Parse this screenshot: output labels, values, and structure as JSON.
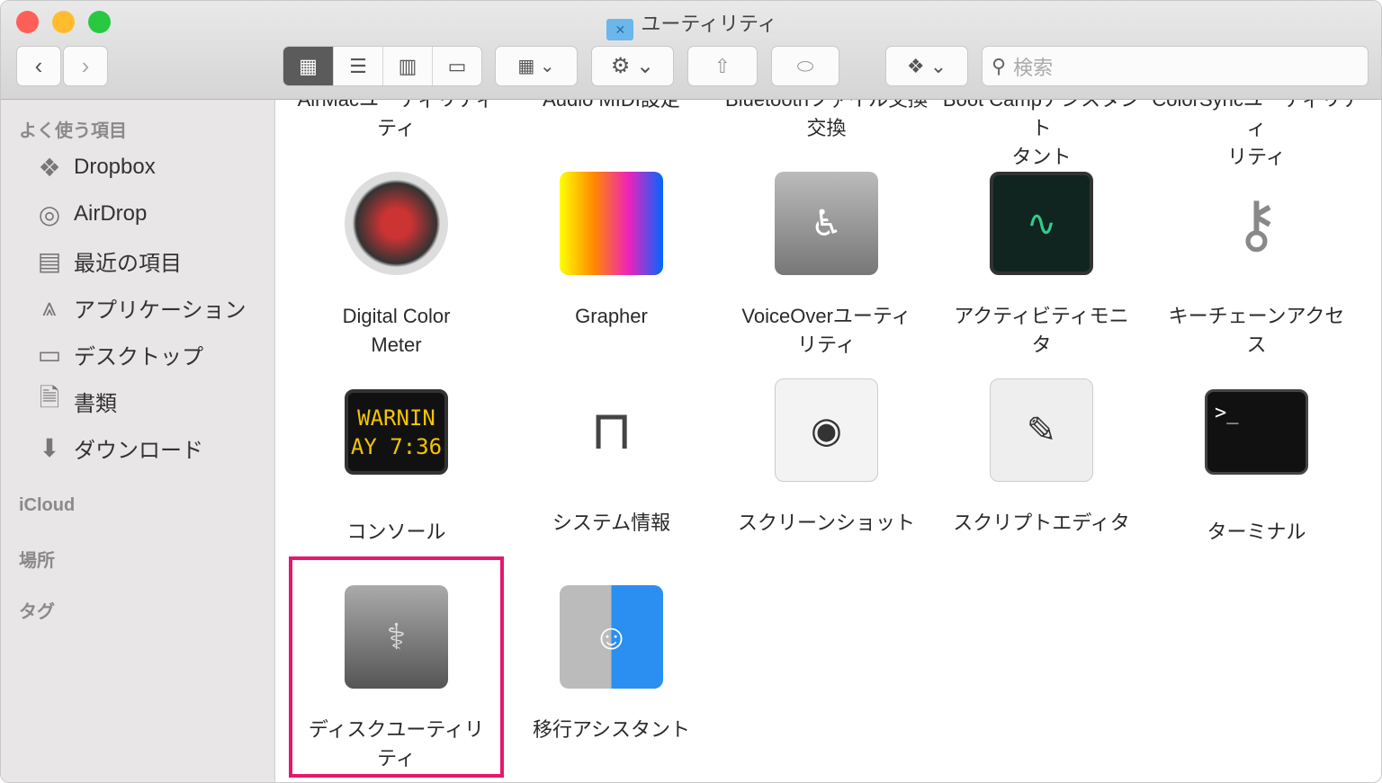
{
  "window": {
    "title": "ユーティリティ"
  },
  "toolbar": {
    "back": "‹",
    "forward": "›",
    "search_placeholder": "検索",
    "view_modes": [
      "icon",
      "list",
      "column",
      "gallery"
    ],
    "active_view": "icon"
  },
  "sidebar": {
    "favorites_header": "よく使う項目",
    "items": [
      {
        "label": "Dropbox",
        "icon": "dropbox-icon"
      },
      {
        "label": "AirDrop",
        "icon": "airdrop-icon"
      },
      {
        "label": "最近の項目",
        "icon": "recents-icon"
      },
      {
        "label": "アプリケーション",
        "icon": "applications-icon"
      },
      {
        "label": "デスクトップ",
        "icon": "desktop-icon"
      },
      {
        "label": "書類",
        "icon": "documents-icon"
      },
      {
        "label": "ダウンロード",
        "icon": "downloads-icon"
      }
    ],
    "icloud_header": "iCloud",
    "locations_header": "場所",
    "tags_header": "タグ"
  },
  "apps_partial": [
    "AirMacユーティリティ",
    "Audio MIDI設定",
    "Bluetoothファイル交換",
    "Boot Campアシスタント",
    "ColorSyncユーティリティ"
  ],
  "apps_partial_line2": [
    "ティ",
    "",
    "交換",
    "タント",
    "リティ"
  ],
  "apps": [
    {
      "line1": "Digital Color",
      "line2": "Meter"
    },
    {
      "line1": "Grapher",
      "line2": ""
    },
    {
      "line1": "VoiceOverユーティ",
      "line2": "リティ"
    },
    {
      "line1": "アクティビティモニ",
      "line2": "タ"
    },
    {
      "line1": "キーチェーンアクセ",
      "line2": "ス"
    },
    {
      "line1": "コンソール",
      "line2": "",
      "icon_text": "WARNIN AY 7:36"
    },
    {
      "line1": "システム情報",
      "line2": ""
    },
    {
      "line1": "スクリーンショット",
      "line2": ""
    },
    {
      "line1": "スクリプトエディタ",
      "line2": ""
    },
    {
      "line1": "ターミナル",
      "line2": "",
      "icon_text": ">_"
    },
    {
      "line1": "ディスクユーティリ",
      "line2": "ティ",
      "selected": true
    },
    {
      "line1": "移行アシスタント",
      "line2": ""
    }
  ],
  "colors": {
    "selection": "#e5186c"
  }
}
